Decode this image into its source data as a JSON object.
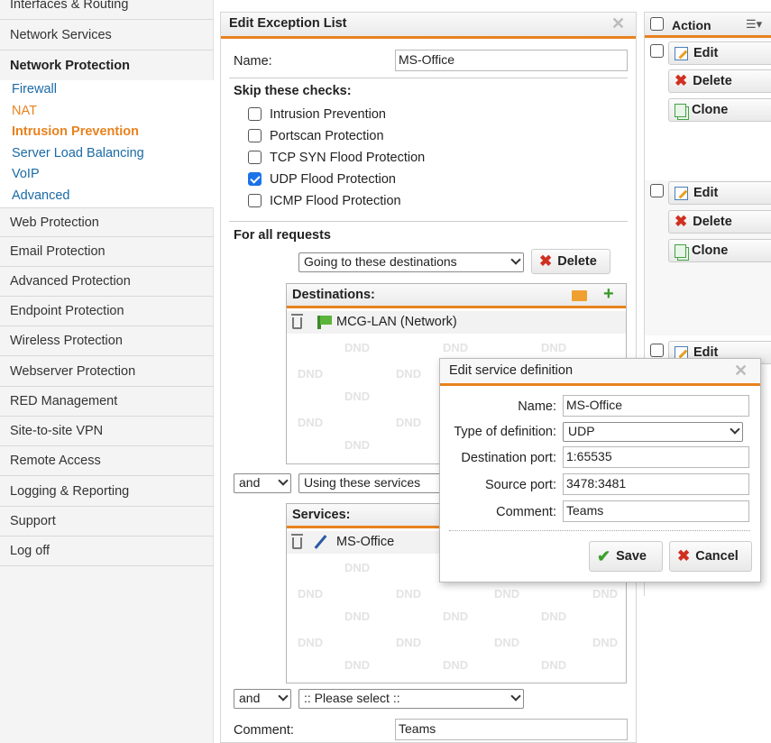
{
  "sidebar": {
    "items": [
      "Interfaces & Routing",
      "Network Services",
      "Network Protection",
      "Web Protection",
      "Email Protection",
      "Advanced Protection",
      "Endpoint Protection",
      "Wireless Protection",
      "Webserver Protection",
      "RED Management",
      "Site-to-site VPN",
      "Remote Access",
      "Logging & Reporting",
      "Support",
      "Log off"
    ],
    "subitems": [
      "Firewall",
      "NAT",
      "Intrusion Prevention",
      "Server Load Balancing",
      "VoIP",
      "Advanced"
    ]
  },
  "panel": {
    "title": "Edit Exception List",
    "name_label": "Name:",
    "name_value": "MS-Office",
    "skip_label": "Skip these checks:",
    "checks": [
      {
        "label": "Intrusion Prevention",
        "checked": false
      },
      {
        "label": "Portscan Protection",
        "checked": false
      },
      {
        "label": "TCP SYN Flood Protection",
        "checked": false
      },
      {
        "label": "UDP Flood Protection",
        "checked": true
      },
      {
        "label": "ICMP Flood Protection",
        "checked": false
      }
    ],
    "for_all_label": "For all requests",
    "dest_select": "Going to these destinations",
    "delete_label": "Delete",
    "destinations_title": "Destinations:",
    "destination_item": "MCG-LAN (Network)",
    "and_label": "and",
    "service_select": "Using these services",
    "services_title": "Services:",
    "service_item": "MS-Office",
    "and2_label": "and",
    "please_select": ":: Please select ::",
    "comment_label": "Comment:",
    "comment_value": "Teams",
    "dnd": "DND"
  },
  "actions": {
    "header": "Action",
    "edit": "Edit",
    "delete": "Delete",
    "clone": "Clone"
  },
  "dialog": {
    "title": "Edit service definition",
    "name_label": "Name:",
    "name_value": "MS-Office",
    "type_label": "Type of definition:",
    "type_value": "UDP",
    "dport_label": "Destination port:",
    "dport_value": "1:65535",
    "sport_label": "Source port:",
    "sport_value": "3478:3481",
    "comment_label": "Comment:",
    "comment_value": "Teams",
    "save": "Save",
    "cancel": "Cancel"
  },
  "colors": {
    "accent": "#e8821e",
    "link": "#1a6aa6",
    "check": "#1a73e8"
  }
}
